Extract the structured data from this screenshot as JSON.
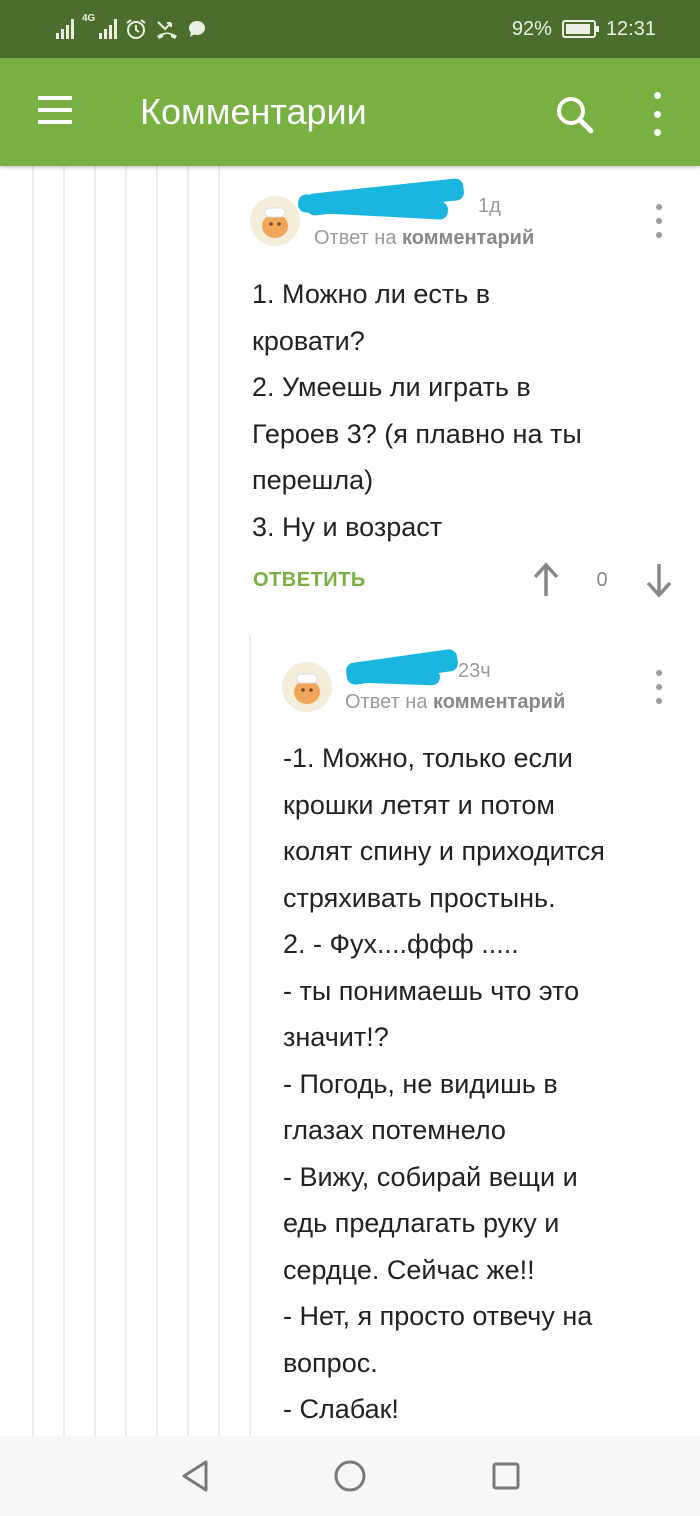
{
  "status_bar": {
    "network": "4G",
    "battery_percent": "92%",
    "battery_level": 0.92,
    "time": "12:31",
    "icons": [
      "signal-icon",
      "signal-icon",
      "alarm-icon",
      "missed-call-icon",
      "chat-icon",
      "battery-icon"
    ]
  },
  "app_bar": {
    "title": "Комментарии",
    "icons": [
      "menu-icon",
      "search-icon",
      "more-vert-icon"
    ]
  },
  "comments": [
    {
      "author": "",
      "time": "1д",
      "reply_prefix": "Ответ на",
      "reply_target": "комментарий",
      "lines": [
        "1. Можно ли есть в",
        "кровати?",
        "2. Умеешь ли играть в",
        "Героев 3? (я плавно на ты",
        "перешла)",
        "3. Ну и возраст"
      ],
      "reply_label": "ОТВЕТИТЬ",
      "rating": "0"
    },
    {
      "author": "",
      "time": "23ч",
      "reply_prefix": "Ответ на",
      "reply_target": "комментарий",
      "lines": [
        "-1. Можно, только если",
        "крошки летят и потом",
        "колят спину и приходится",
        "стряхивать простынь.",
        "2. - Фух....ффф .....",
        "- ты понимаешь что это",
        "значит!?",
        "- Погодь, не видишь в",
        "глазах потемнело",
        "- Вижу, собирай вещи и",
        "едь предлагать руку и",
        "сердце. Сейчас же!!",
        "- Нет, я просто отвечу на",
        "вопрос.",
        "- Слабак!"
      ]
    }
  ],
  "nav_bar": {
    "icons": [
      "back-icon",
      "home-icon",
      "recents-icon"
    ]
  },
  "colors": {
    "status_bar": "#4b6e2d",
    "app_bar": "#78b042",
    "accent": "#78b042",
    "redaction": "#1bb6e0"
  }
}
